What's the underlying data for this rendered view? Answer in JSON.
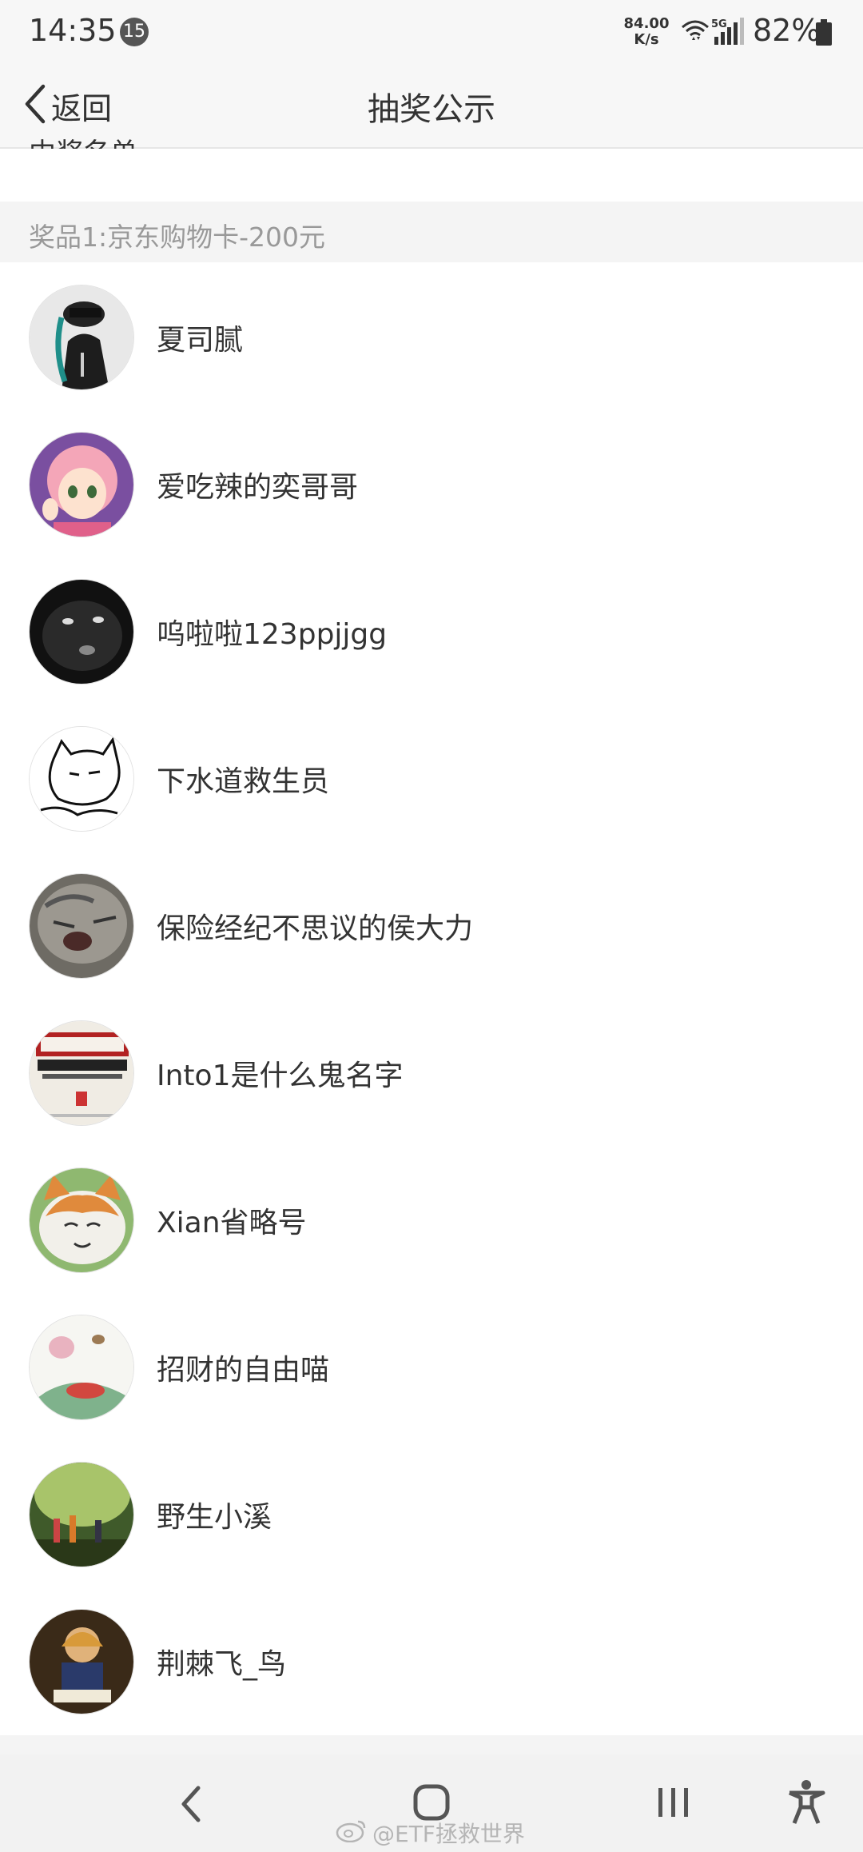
{
  "status_bar": {
    "time": "14:35",
    "notification_count": "15",
    "net_speed_value": "84.00",
    "net_speed_unit": "K/s",
    "network_type": "5G",
    "battery": "82%"
  },
  "header": {
    "back_label": "返回",
    "title": "抽奖公示"
  },
  "section_title": "中奖名单",
  "prize": {
    "label": "奖品1:京东购物卡-200元"
  },
  "winners": [
    {
      "name": "夏司腻",
      "avatar": "person-dark-avatar"
    },
    {
      "name": "爱吃辣的奕哥哥",
      "avatar": "anime-girl-avatar"
    },
    {
      "name": "呜啦啦123ppjjgg",
      "avatar": "black-cat-avatar"
    },
    {
      "name": "下水道救生员",
      "avatar": "cat-sketch-avatar"
    },
    {
      "name": "保险经纪不思议的侯大力",
      "avatar": "grey-cat-avatar"
    },
    {
      "name": "Into1是什么鬼名字",
      "avatar": "icac-book-avatar"
    },
    {
      "name": "Xian省略号",
      "avatar": "smiling-cat-avatar"
    },
    {
      "name": "招财的自由喵",
      "avatar": "lotus-art-avatar"
    },
    {
      "name": "野生小溪",
      "avatar": "forest-kids-avatar"
    },
    {
      "name": "荆棘飞_鸟",
      "avatar": "reading-child-avatar"
    }
  ],
  "watermark": "@ETF拯救世界",
  "colors": {
    "header_bg": "#f7f7f7",
    "prize_text": "#999999",
    "text": "#333333"
  }
}
